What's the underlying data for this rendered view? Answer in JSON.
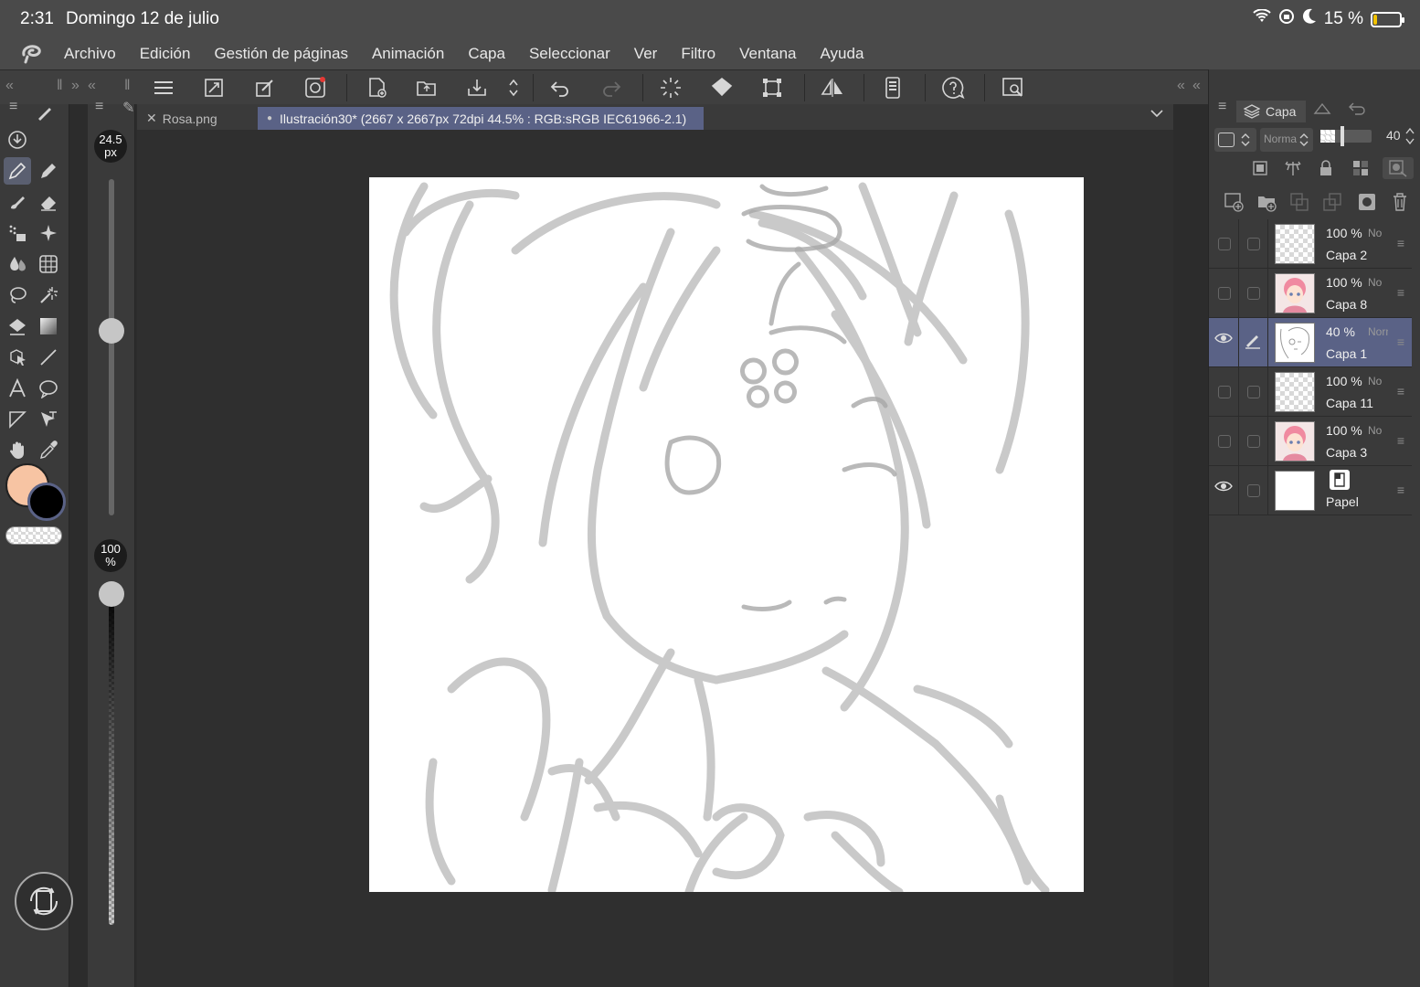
{
  "status_bar": {
    "time": "2:31",
    "date": "Domingo 12 de julio",
    "battery_text": "15 %",
    "battery_level": 0.15
  },
  "menu": {
    "items": [
      "Archivo",
      "Edición",
      "Gestión de páginas",
      "Animación",
      "Capa",
      "Seleccionar",
      "Ver",
      "Filtro",
      "Ventana",
      "Ayuda"
    ]
  },
  "brush": {
    "size_value": "24.5",
    "size_unit": "px",
    "opacity_value": "100",
    "opacity_unit": "%",
    "size_level": 0.55,
    "opacity_level": 1.0
  },
  "colors": {
    "main": "#f7c4a3",
    "sub": "#000000"
  },
  "tabs": [
    {
      "label": "Rosa.png",
      "active": false
    },
    {
      "label": "Ilustración30* (2667 x 2667px 72dpi 44.5% : RGB:sRGB IEC61966-2.1)",
      "active": true
    }
  ],
  "layer_panel": {
    "tab_label": "Capa",
    "blend_mode": "Norma",
    "opacity": "40",
    "layers": [
      {
        "opacity": "100 %",
        "mode": "No",
        "name": "Capa 2",
        "visible": false,
        "selected": false,
        "thumb": "checker"
      },
      {
        "opacity": "100 %",
        "mode": "No",
        "name": "Capa 8",
        "visible": false,
        "selected": false,
        "thumb": "art"
      },
      {
        "opacity": "40 %",
        "mode": "Norm",
        "name": "Capa 1",
        "visible": true,
        "selected": true,
        "thumb": "sketch"
      },
      {
        "opacity": "100 %",
        "mode": "No",
        "name": "Capa 11",
        "visible": false,
        "selected": false,
        "thumb": "checker"
      },
      {
        "opacity": "100 %",
        "mode": "No",
        "name": "Capa 3",
        "visible": false,
        "selected": false,
        "thumb": "art"
      },
      {
        "opacity": "",
        "mode": "",
        "name": "Papel",
        "visible": true,
        "selected": false,
        "thumb": "paper"
      }
    ]
  }
}
